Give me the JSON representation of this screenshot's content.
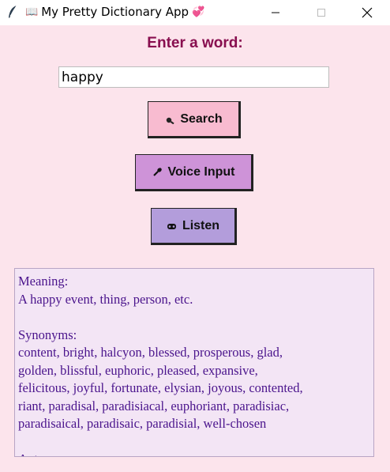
{
  "window": {
    "title": "My Pretty Dictionary App",
    "title_prefix_glyph": "📖",
    "title_suffix_glyph": "💞",
    "icon": "feather-icon",
    "controls": [
      "minimize-icon",
      "maximize-icon",
      "close-icon"
    ]
  },
  "form": {
    "heading": "Enter a word:",
    "word_value": "happy"
  },
  "buttons": {
    "search": {
      "label": "Search",
      "icon": "magnifier-icon",
      "color": "#f8bbd0"
    },
    "voice": {
      "label": "Voice Input",
      "icon": "microphone-icon",
      "color": "#ce93d8"
    },
    "listen": {
      "label": "Listen",
      "icon": "speaker-icon",
      "color": "#b39ddb"
    }
  },
  "result": {
    "meaning_label": "Meaning:",
    "meaning_text": "A happy event, thing, person, etc.",
    "synonyms_label": "Synonyms:",
    "synonyms_lines": [
      "content, bright, halcyon, blessed, prosperous, glad,",
      "golden, blissful, euphoric, pleased, expansive,",
      "felicitous, joyful, fortunate, elysian, joyous, contented,",
      "riant, paradisal, paradisiacal, euphoriant, paradisiac,",
      "paradisaical, paradisaic, paradisial, well-chosen"
    ],
    "antonyms_label_partial": "Ant..."
  },
  "colors": {
    "background": "#fce4ec",
    "heading": "#880e4f",
    "result_bg": "#f3e5f5",
    "result_text": "#4a148c"
  }
}
